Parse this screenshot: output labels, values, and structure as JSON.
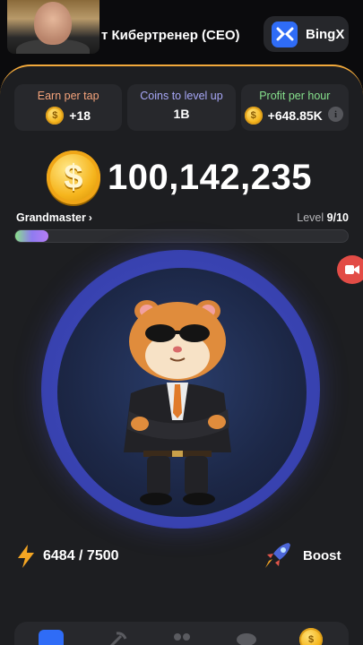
{
  "header": {
    "user_name": "т Кибертренер (CEO)",
    "exchange_label": "BingX"
  },
  "stats": [
    {
      "label": "Earn per tap",
      "value": "+18",
      "label_color": "#f4a37b"
    },
    {
      "label": "Coins to level up",
      "value": "1B",
      "label_color": "#a7a7f7"
    },
    {
      "label": "Profit per hour",
      "value": "+648.85K",
      "label_color": "#86e08c"
    }
  ],
  "balance": {
    "value": "100,142,235"
  },
  "rank": {
    "name": "Grandmaster",
    "level_prefix": "Level",
    "level_value": "9/10",
    "progress_fraction": 0.1
  },
  "energy": {
    "value": "6484 / 7500"
  },
  "boost": {
    "label": "Boost"
  },
  "icons": {
    "coin": "coin-icon",
    "info": "info-icon",
    "energy": "lightning-icon",
    "boost": "rocket-icon",
    "exchange": "bingx-logo-icon",
    "record": "video-record-icon"
  },
  "colors": {
    "accent": "#f2a93b",
    "panel": "#1d1e21",
    "card": "#27282c",
    "tap_ring": "#3842b0"
  }
}
